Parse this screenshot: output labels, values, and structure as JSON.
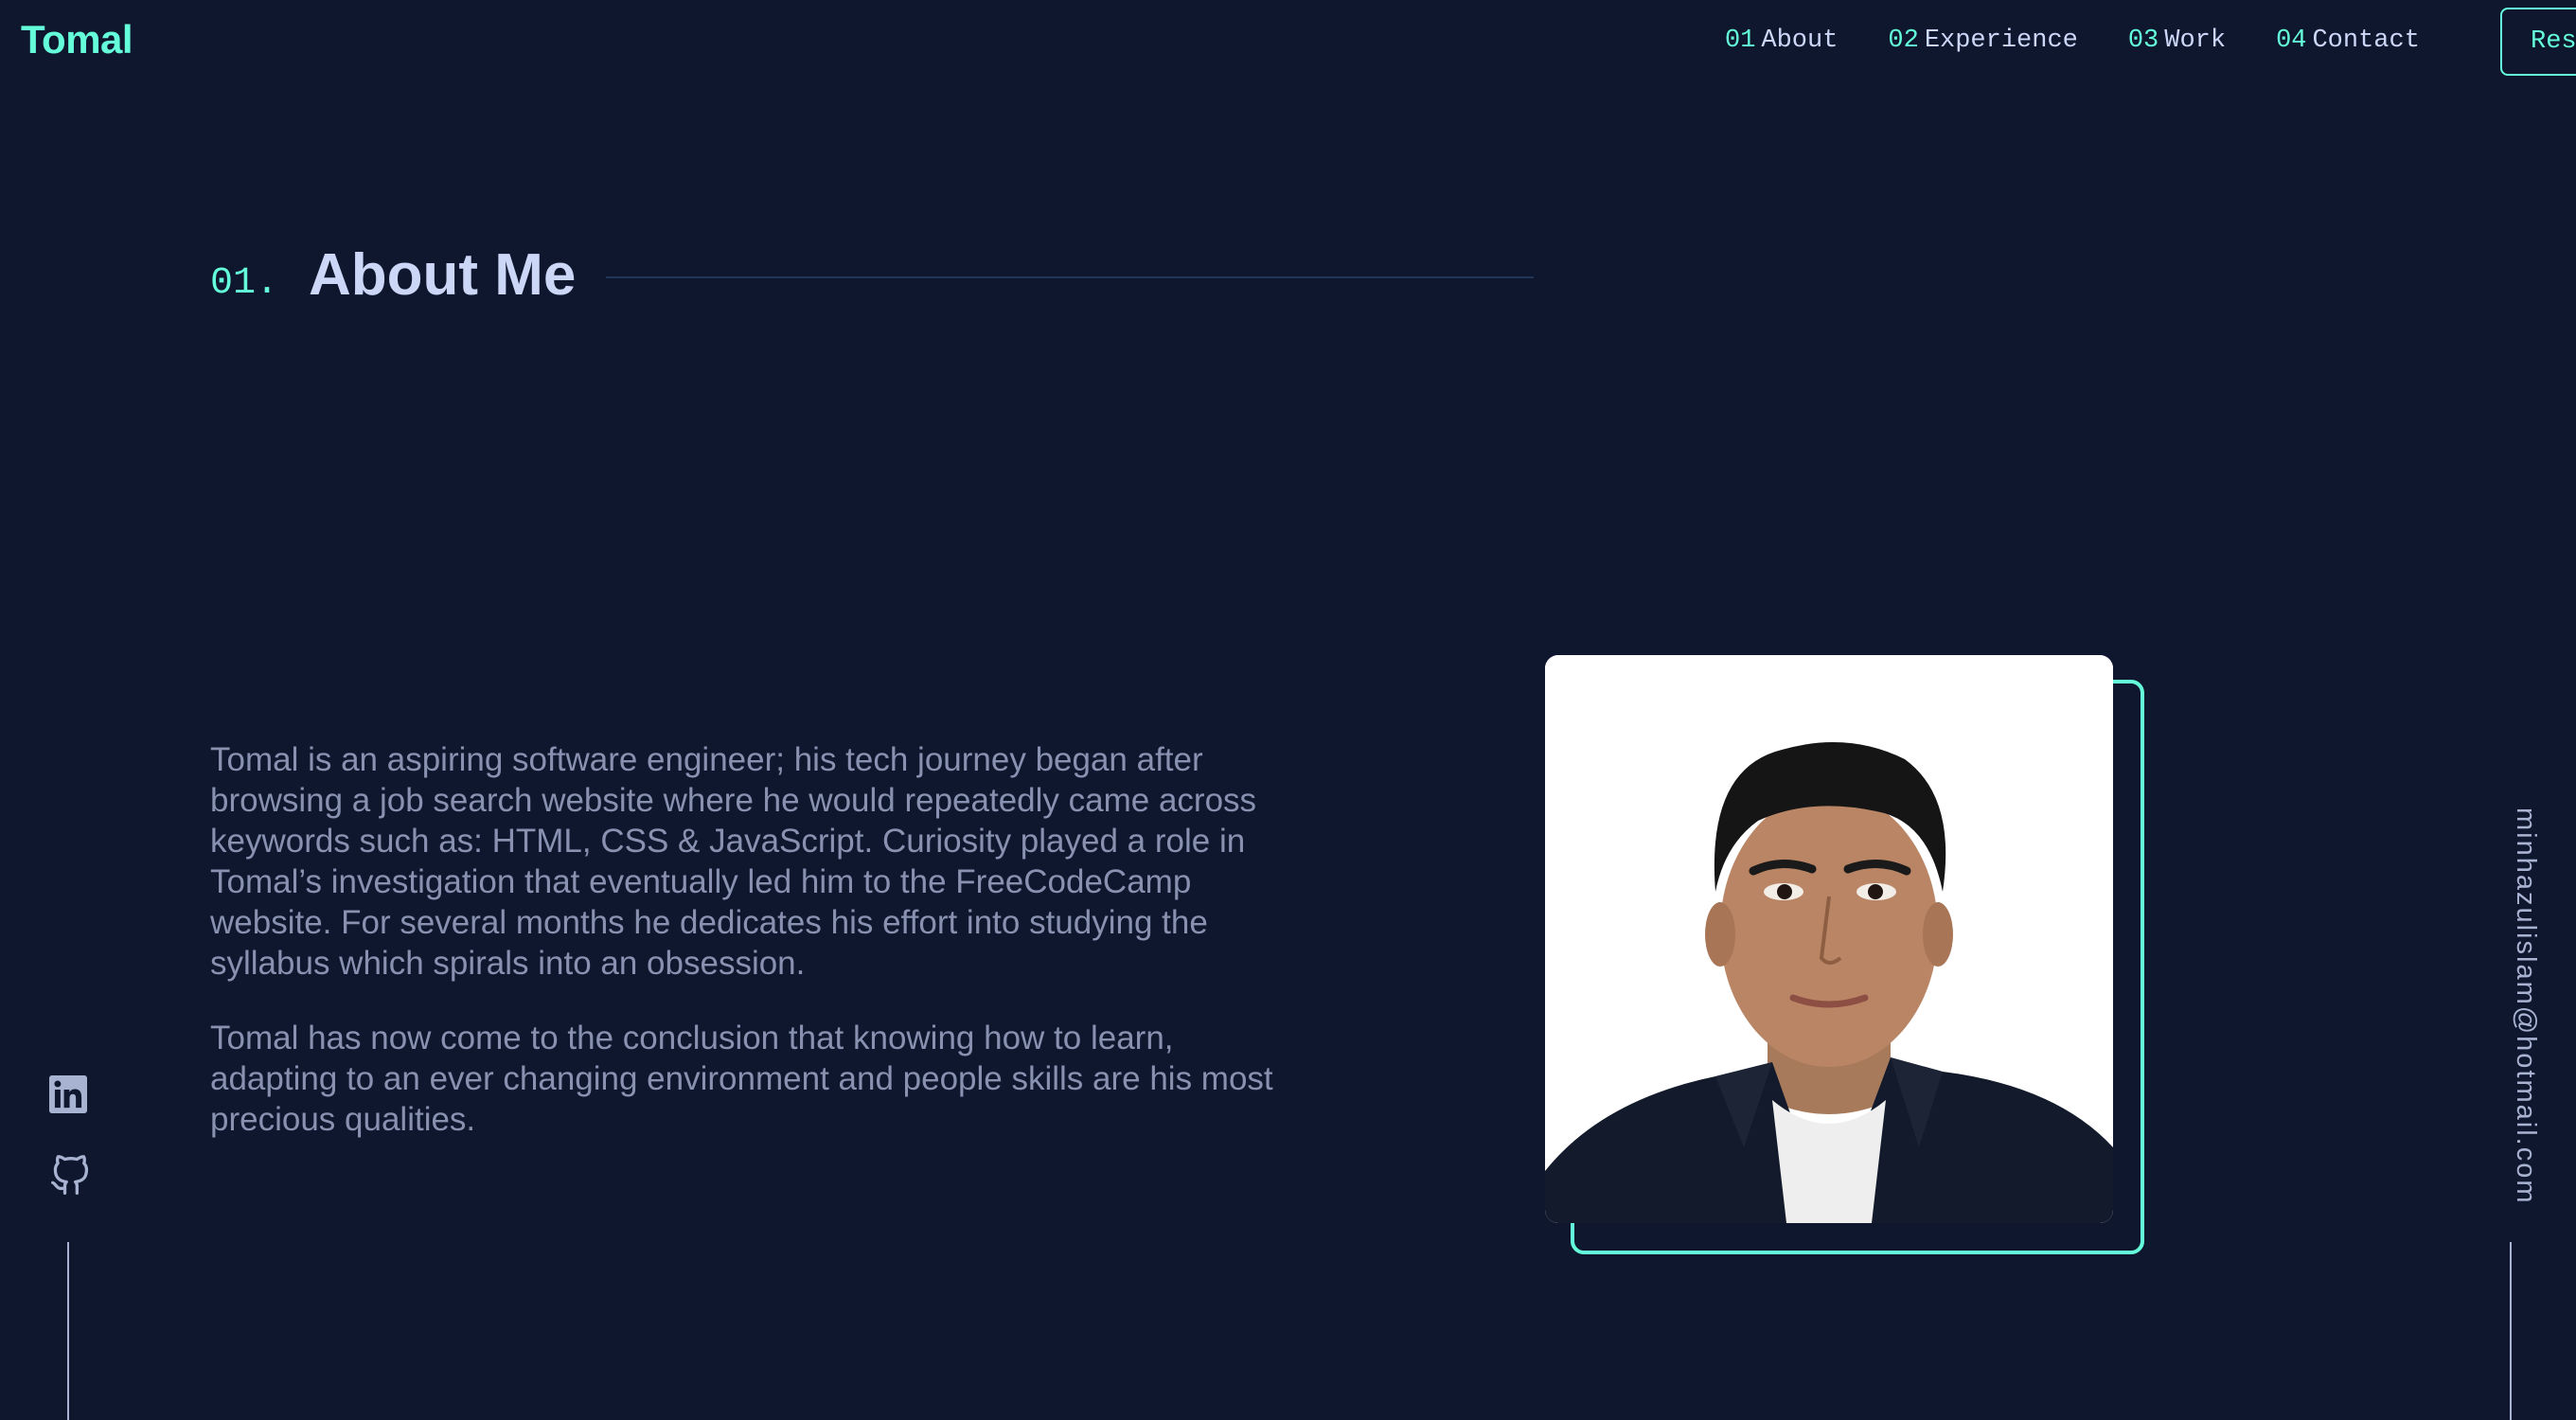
{
  "header": {
    "logo": "Tomal",
    "nav": [
      {
        "num": "01",
        "label": "About"
      },
      {
        "num": "02",
        "label": "Experience"
      },
      {
        "num": "03",
        "label": "Work"
      },
      {
        "num": "04",
        "label": "Contact"
      }
    ],
    "resume_label": "Resume"
  },
  "about": {
    "section_num": "01.",
    "title": "About Me",
    "paragraphs": [
      "Tomal is an aspiring software engineer; his tech journey began after browsing a job search website where he would repeatedly came across keywords such as: HTML, CSS & JavaScript. Curiosity played a role in Tomal’s investigation that eventually led him to the FreeCodeCamp website. For several months he dedicates his effort into studying the syllabus which spirals into an obsession.",
      "Tomal has now come to the conclusion that knowing how to learn, adapting to an ever changing environment and people skills are his most precious qualities."
    ],
    "photo_icon": "profile-photo"
  },
  "sidebar": {
    "social": [
      {
        "icon": "linkedin-icon"
      },
      {
        "icon": "github-icon"
      }
    ],
    "email": "minhazulislam@hotmail.com"
  },
  "colors": {
    "background": "#0f172e",
    "accent": "#64ffda",
    "heading": "#ccd6f6",
    "body_text": "#8892b0"
  }
}
